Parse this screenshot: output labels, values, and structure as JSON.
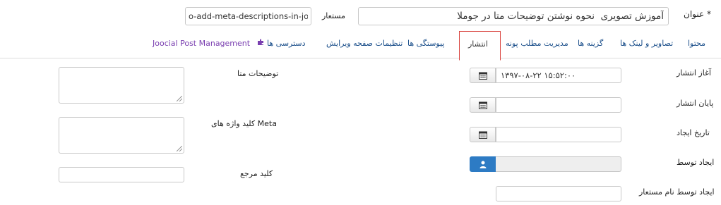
{
  "header": {
    "title_label": "عنوان *",
    "title_value": "آموزش تصویری  نحوه نوشتن توضیحات متا در جوملا",
    "alias_label": "مستعار",
    "alias_value": "o-add-meta-descriptions-in-joomla"
  },
  "tabs": [
    {
      "label": "محتوا"
    },
    {
      "label": "تصاویر و لینک ها"
    },
    {
      "label": "گزینه ها"
    },
    {
      "label": "مدیریت مطلب پونه"
    },
    {
      "label": "انتشار"
    },
    {
      "label": "پیوستگی ها"
    },
    {
      "label": "تنظیمات صفحه ویرایش"
    },
    {
      "label": "دسترسی ها"
    },
    {
      "label": "Joocial Post Management"
    }
  ],
  "active_tab": "انتشار",
  "publishing": {
    "start_label": "آغاز انتشار",
    "start_value": "۱۳۹۷-۰۸-۲۲ ۱۵:۵۲:۰۰",
    "finish_label": "پایان انتشار",
    "finish_value": "",
    "created_label": "تاریخ ایجاد",
    "created_value": "",
    "created_by_label": "ایجاد توسط",
    "created_by_alias_label": "ایجاد توسط نام مستعار",
    "created_by_alias_value": ""
  },
  "metadata": {
    "meta_description_label": "توضیحات متا",
    "meta_keywords_label": "کلید واژه های Meta",
    "key_reference_label": "کلید مرجع"
  },
  "colors": {
    "active_tab_border": "#d9413c",
    "user_button": "#2d7bc4",
    "tab_link": "#1a4e8a",
    "joocial": "#7a3fb0"
  },
  "icons": {
    "calendar": "calendar-icon",
    "user": "user-icon",
    "joocial": "joocial-puzzle-icon"
  }
}
